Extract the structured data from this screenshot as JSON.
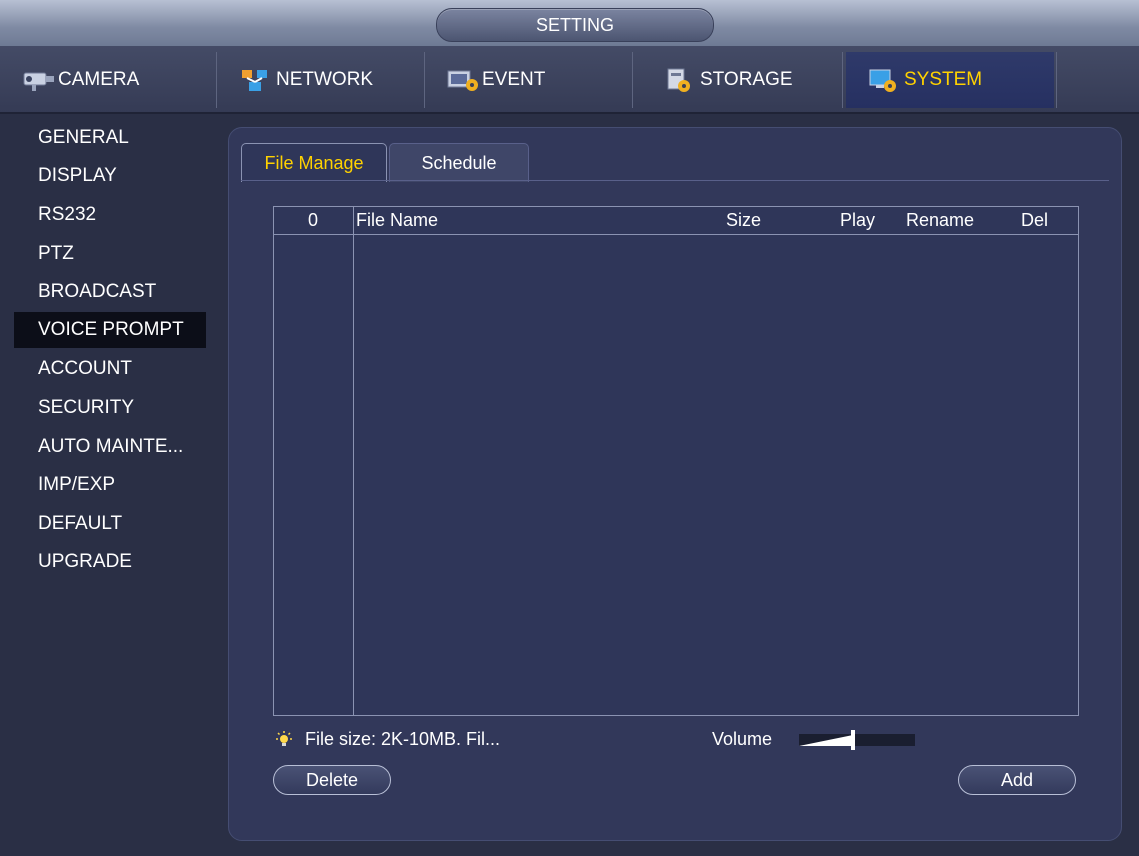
{
  "window": {
    "title": "SETTING"
  },
  "top_tabs": [
    {
      "label": "CAMERA",
      "icon": "camera-icon"
    },
    {
      "label": "NETWORK",
      "icon": "network-icon"
    },
    {
      "label": "EVENT",
      "icon": "event-icon"
    },
    {
      "label": "STORAGE",
      "icon": "storage-icon"
    },
    {
      "label": "SYSTEM",
      "icon": "system-icon",
      "active": true
    }
  ],
  "sidebar": {
    "items": [
      {
        "label": "GENERAL"
      },
      {
        "label": "DISPLAY"
      },
      {
        "label": "RS232"
      },
      {
        "label": "PTZ"
      },
      {
        "label": "BROADCAST"
      },
      {
        "label": "VOICE PROMPT",
        "active": true
      },
      {
        "label": "ACCOUNT"
      },
      {
        "label": "SECURITY"
      },
      {
        "label": "AUTO MAINTE..."
      },
      {
        "label": "IMP/EXP"
      },
      {
        "label": "DEFAULT"
      },
      {
        "label": "UPGRADE"
      }
    ]
  },
  "sub_tabs": {
    "file_manage": "File Manage",
    "schedule": "Schedule"
  },
  "table": {
    "columns": {
      "index": "0",
      "file_name": "File Name",
      "size": "Size",
      "play": "Play",
      "rename": "Rename",
      "del": "Del"
    },
    "rows": []
  },
  "footer": {
    "note": "File size: 2K-10MB. Fil...",
    "volume_label": "Volume",
    "volume_level": 0.55,
    "delete_label": "Delete",
    "add_label": "Add"
  },
  "colors": {
    "active_text": "#ffd200",
    "background": "#2a2f45",
    "panel": "#32385a",
    "active_tab": "#263061"
  }
}
